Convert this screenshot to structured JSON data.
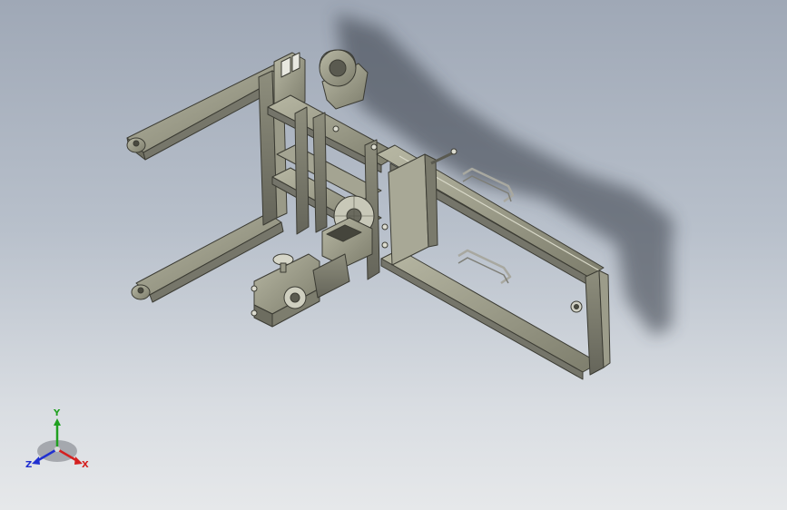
{
  "viewport": {
    "background_top": "#9fa8b6",
    "background_bottom": "#e6e8ea",
    "model_color": "#8a8a78",
    "shadow_color": "#3a3f48"
  },
  "triad": {
    "x_label": "X",
    "y_label": "Y",
    "z_label": "Z",
    "x_color": "#d42020",
    "y_color": "#20a020",
    "z_color": "#2030d0"
  }
}
